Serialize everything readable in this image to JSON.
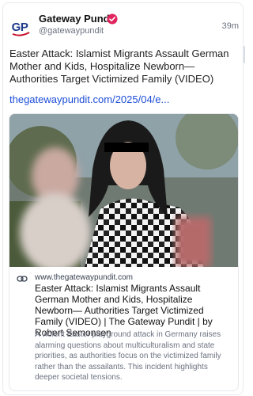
{
  "post": {
    "author_name": "Gateway Pundit",
    "author_handle": "@gatewaypundit",
    "avatar_text": "GP",
    "verified_icon": "verified-badge-icon",
    "time": "39m",
    "text": "Easter Attack: Islamist Migrants Assault German Mother and Kids, Hospitalize Newborn— Authorities Target Victimized Family (VIDEO)",
    "link_text": "thegatewaypundit.com/2025/04/e..."
  },
  "embed": {
    "domain": "www.thegatewaypundit.com",
    "title": "Easter Attack: Islamist Migrants Assault German Mother and Kids, Hospitalize Newborn— Authorities Target Victimized Family (VIDEO) | The Gateway Pundit | by Robert Semonsen",
    "description": "A violent Easter playground attack in Germany raises alarming questions about multiculturalism and state priorities, as authorities focus on the victimized family rather than the assailants. This incident highlights deeper societal tensions.",
    "link_icon": "link-icon"
  },
  "colors": {
    "link": "#1d4ed8",
    "verified": "#e0245e",
    "avatar_blue": "#1e3a8a",
    "avatar_red": "#c8102e"
  }
}
